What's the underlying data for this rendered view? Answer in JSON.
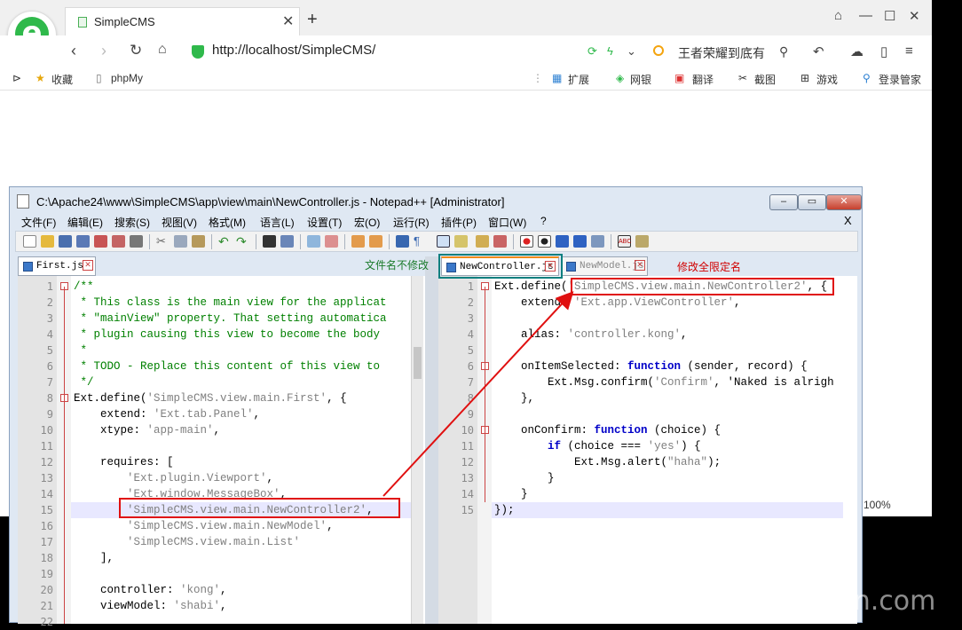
{
  "browser": {
    "tab_title": "SimpleCMS",
    "url": "http://localhost/SimpleCMS/",
    "search_text": "王者荣耀到底有",
    "bookmarks": {
      "favorites": "收藏",
      "phpmy": "phpMy",
      "extensions": "扩展",
      "netbank": "网银",
      "translate": "翻译",
      "screenshot": "截图",
      "games": "游戏",
      "login": "登录管家"
    },
    "zoom": "100%"
  },
  "notepad": {
    "title": "C:\\Apache24\\www\\SimpleCMS\\app\\view\\main\\NewController.js - Notepad++ [Administrator]",
    "menu": [
      "文件(F)",
      "编辑(E)",
      "搜索(S)",
      "视图(V)",
      "格式(M)",
      "语言(L)",
      "设置(T)",
      "宏(O)",
      "运行(R)",
      "插件(P)",
      "窗口(W)",
      "?"
    ],
    "menu_close": "X",
    "left_tab": "First.js",
    "right_tabs": [
      "NewController.js",
      "NewModel.js"
    ],
    "left_lines": [
      "/**",
      " * This class is the main view for the applicat",
      " * \"mainView\" property. That setting automatica",
      " * plugin causing this view to become the body",
      " *",
      " * TODO - Replace this content of this view to",
      " */",
      "Ext.define('SimpleCMS.view.main.First', {",
      "    extend: 'Ext.tab.Panel',",
      "    xtype: 'app-main',",
      "",
      "    requires: [",
      "        'Ext.plugin.Viewport',",
      "        'Ext.window.MessageBox',",
      "        'SimpleCMS.view.main.NewController2',",
      "        'SimpleCMS.view.main.NewModel',",
      "        'SimpleCMS.view.main.List'",
      "    ],",
      "",
      "    controller: 'kong',",
      "    viewModel: 'shabi',",
      ""
    ],
    "right_lines": [
      "Ext.define('SimpleCMS.view.main.NewController2', {",
      "    extend: 'Ext.app.ViewController',",
      "",
      "    alias: 'controller.kong',",
      "",
      "    onItemSelected: function (sender, record) {",
      "        Ext.Msg.confirm('Confirm', 'Naked is alrigh",
      "    },",
      "",
      "    onConfirm: function (choice) {",
      "        if (choice === 'yes') {",
      "            Ext.Msg.alert(\"haha\");",
      "        }",
      "    }",
      "});"
    ]
  },
  "annotations": {
    "filename_unchanged": "文件名不修改",
    "change_fqn": "修改全限定名"
  },
  "watermark": "云栖社区 yq.aliyun.com"
}
